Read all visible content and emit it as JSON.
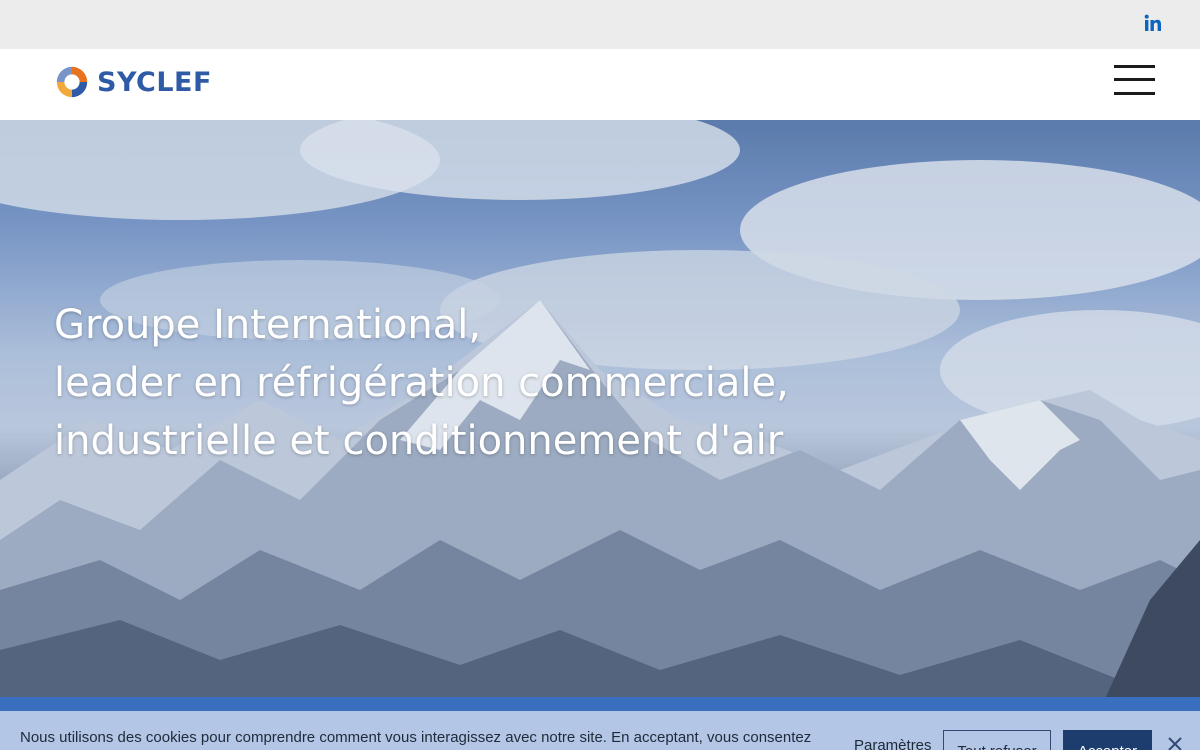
{
  "topbar": {
    "social_icon": "linkedin-icon"
  },
  "header": {
    "logo_text": "SYCLEF",
    "menu_icon": "hamburger-menu-icon"
  },
  "hero": {
    "title_lines": [
      "Groupe International,",
      "leader en réfrigération commerciale,",
      "industrielle et conditionnement d'air"
    ]
  },
  "cookie_banner": {
    "message": "Nous utilisons des cookies pour comprendre comment vous interagissez avec notre site. En acceptant, vous consentez à notre utilisation de ces cookies. Politique de cookies",
    "settings_label": "Paramètres",
    "refuse_label": "Tout refuser",
    "accept_label": "Accepter",
    "close_icon": "close-icon"
  },
  "colors": {
    "brand_blue": "#2f5aa6",
    "linkedin_blue": "#0a66c2",
    "band_blue": "#3a6fc0",
    "accept_button": "#1d3d6e"
  }
}
